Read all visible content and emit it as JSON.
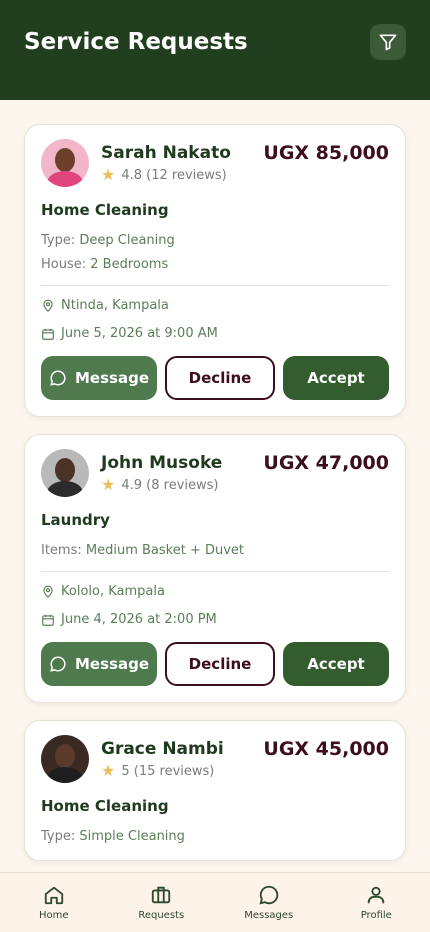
{
  "header": {
    "title": "Service Requests",
    "filter_icon": "filter-icon"
  },
  "requests": [
    {
      "name": "Sarah Nakato",
      "rating": "4.8",
      "reviews": "(12 reviews)",
      "price": "UGX 85,000",
      "service": "Home Cleaning",
      "details": [
        {
          "label": "Type:",
          "value": "Deep Cleaning"
        },
        {
          "label": "House:",
          "value": "2 Bedrooms"
        }
      ],
      "location": "Ntinda, Kampala",
      "date": "June 5, 2026 at 9:00 AM"
    },
    {
      "name": "John Musoke",
      "rating": "4.9",
      "reviews": "(8 reviews)",
      "price": "UGX 47,000",
      "service": "Laundry",
      "details": [
        {
          "label": "Items:",
          "value": "Medium Basket + Duvet"
        }
      ],
      "location": "Kololo, Kampala",
      "date": "June 4, 2026 at 2:00 PM"
    },
    {
      "name": "Grace Nambi",
      "rating": "5",
      "reviews": "(15 reviews)",
      "price": "UGX 45,000",
      "service": "Home Cleaning",
      "details": [
        {
          "label": "Type:",
          "value": "Simple Cleaning"
        }
      ]
    }
  ],
  "actions": {
    "message": "Message",
    "decline": "Decline",
    "accept": "Accept"
  },
  "nav": [
    {
      "label": "Home",
      "icon": "home-icon"
    },
    {
      "label": "Requests",
      "icon": "briefcase-icon"
    },
    {
      "label": "Messages",
      "icon": "chat-bubble-icon"
    },
    {
      "label": "Profile",
      "icon": "user-icon"
    }
  ],
  "colors": {
    "header_bg": "#213f1f",
    "page_bg": "#fdf6ee",
    "message_button": "#4f7a4d",
    "accept_button": "#335c2f",
    "decline_border": "#3c0f1a",
    "price_text": "#3c0f1a",
    "star": "#e8c15a"
  }
}
